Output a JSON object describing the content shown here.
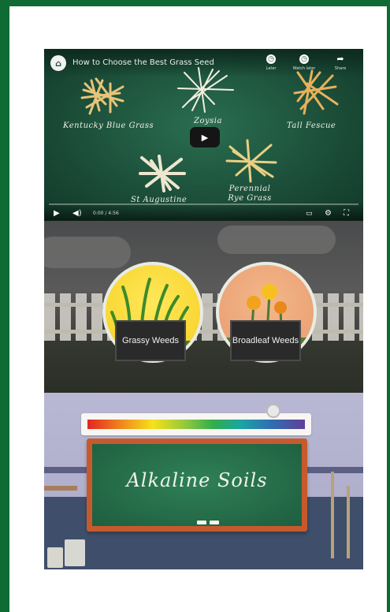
{
  "video": {
    "channel_logo": "logo-icon",
    "title": "How to Choose the Best Grass Seed",
    "top_actions": [
      {
        "icon": "clock-icon",
        "label": "Later"
      },
      {
        "icon": "clock-icon",
        "label": "Watch later"
      },
      {
        "icon": "share-icon",
        "label": "Share"
      }
    ],
    "seeds": {
      "kentucky": "Kentucky Blue Grass",
      "zoysia": "Zoysia",
      "tall_fescue": "Tall Fescue",
      "st_augustine": "St Augustine",
      "perennial": "Perennial Rye Grass"
    },
    "time": "0:00 / 4:56"
  },
  "weeds": {
    "grassy": "Grassy Weeds",
    "broadleaf": "Broadleaf Weeds"
  },
  "alkaline": {
    "board_text": "Alkaline Soils"
  },
  "colors": {
    "frame": "#0f6a34",
    "chalkboard": "#1e5e3f",
    "board_frame": "#c75a2d"
  }
}
